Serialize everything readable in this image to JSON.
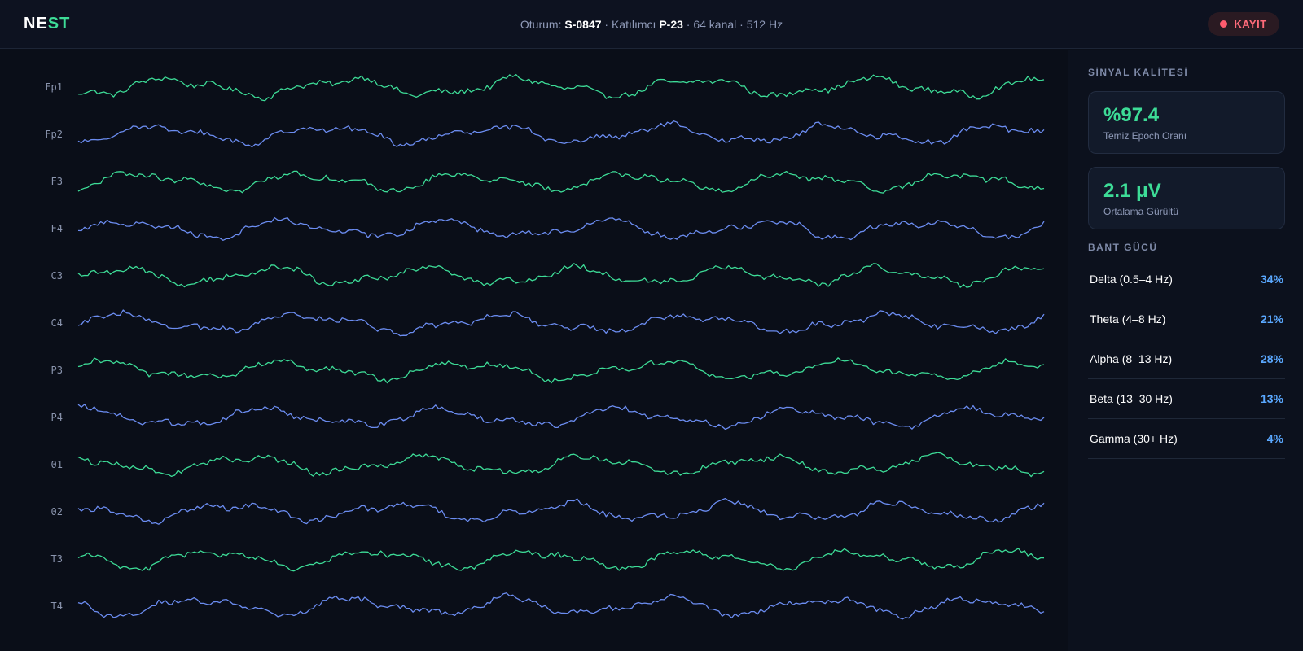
{
  "header": {
    "logo_part1": "NE",
    "logo_part2": "ST",
    "session_label": "Oturum:",
    "session_id": "S-0847",
    "participant_label": "· Katılımcı",
    "participant_id": "P-23",
    "channels_info": "· 64 kanal · 512 Hz",
    "rec_label": "KAYIT"
  },
  "channels": [
    "Fp1",
    "Fp2",
    "F3",
    "F4",
    "C3",
    "C4",
    "P3",
    "P4",
    "01",
    "02",
    "T3",
    "T4"
  ],
  "colors": {
    "green": "#3ddc97",
    "blue": "#6b8cf0",
    "accent_red": "#ff5b6e"
  },
  "signal_quality": {
    "title": "SİNYAL KALİTESİ",
    "clean_epoch_value": "%97.4",
    "clean_epoch_label": "Temiz Epoch Oranı",
    "noise_value": "2.1 μV",
    "noise_label": "Ortalama Gürültü"
  },
  "band_power": {
    "title": "BANT GÜCÜ",
    "bands": [
      {
        "name": "Delta (0.5–4 Hz)",
        "value": "34%"
      },
      {
        "name": "Theta (4–8 Hz)",
        "value": "21%"
      },
      {
        "name": "Alpha (8–13 Hz)",
        "value": "28%"
      },
      {
        "name": "Beta (13–30 Hz)",
        "value": "13%"
      },
      {
        "name": "Gamma (30+ Hz)",
        "value": "4%"
      }
    ]
  }
}
